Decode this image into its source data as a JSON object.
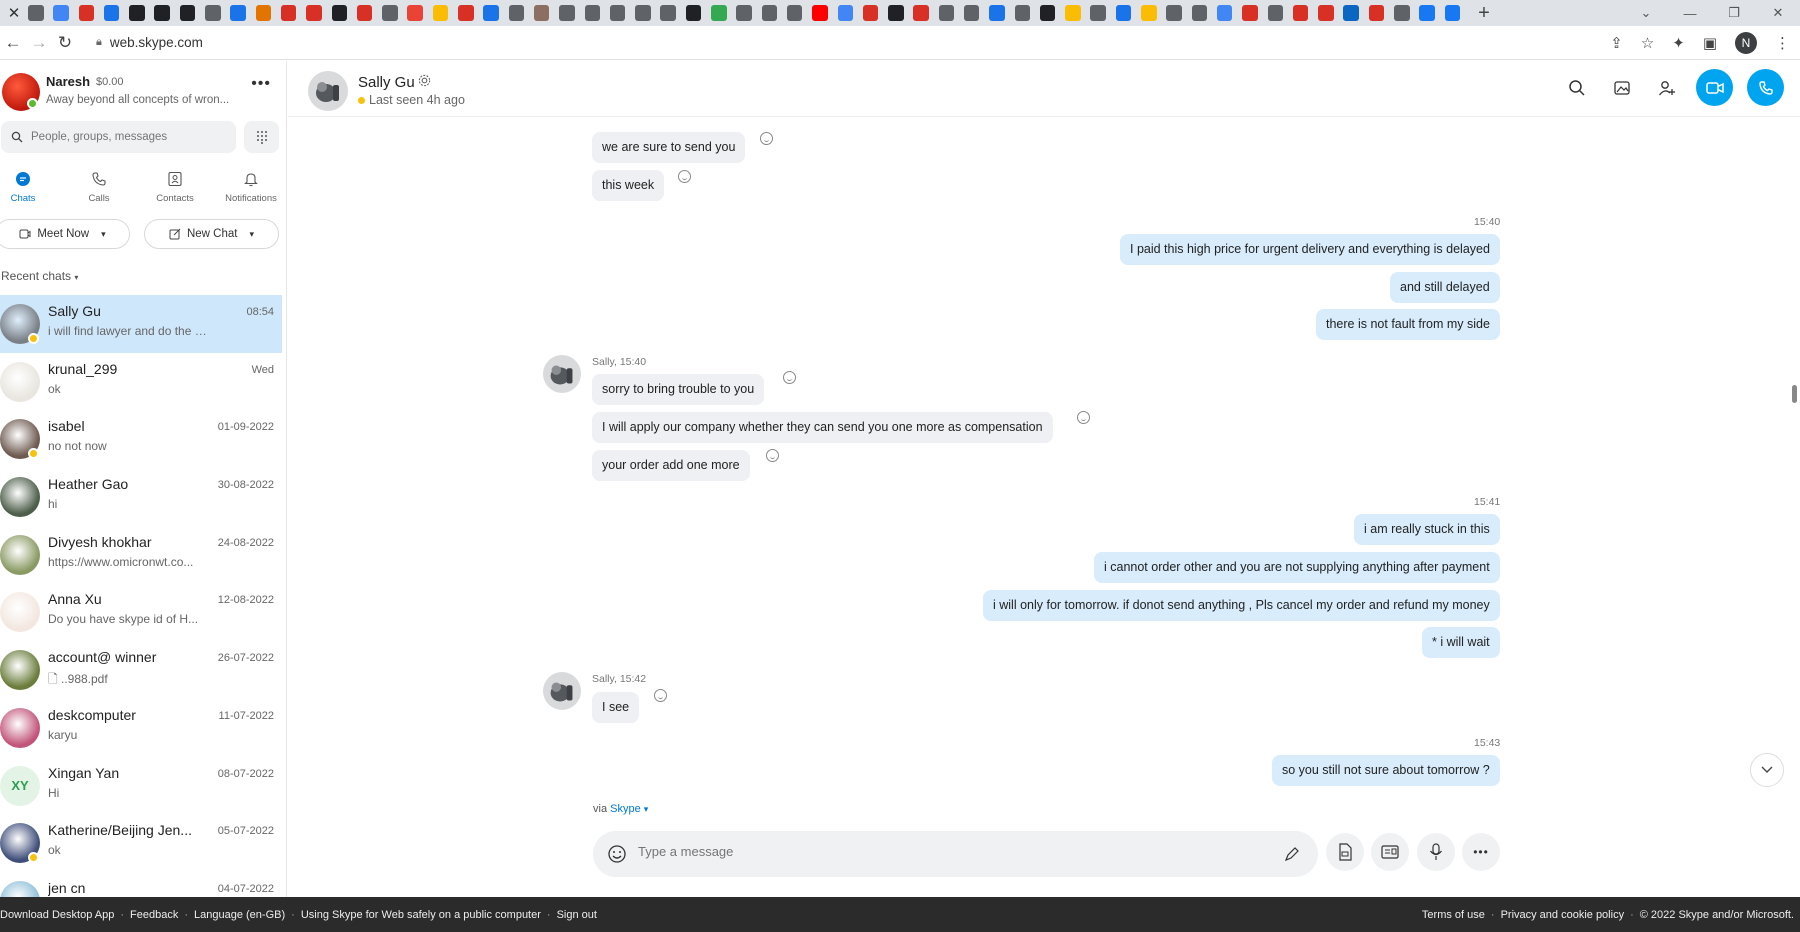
{
  "browser": {
    "url": "web.skype.com",
    "favicon_colors": [
      "#5f6368",
      "#4285f4",
      "#d93025",
      "#1a73e8",
      "#202124",
      "#202124",
      "#202124",
      "#5f6368",
      "#1a73e8",
      "#e37400",
      "#d93025",
      "#d93025",
      "#202124",
      "#d93025",
      "#5f6368",
      "#ea4335",
      "#fbbc04",
      "#d93025",
      "#1a73e8",
      "#5f6368",
      "#8d6e63",
      "#5f6368",
      "#5f6368",
      "#5f6368",
      "#5f6368",
      "#5f6368",
      "#202124",
      "#34a853",
      "#5f6368",
      "#5f6368",
      "#5f6368",
      "#ff0000",
      "#4285f4",
      "#d93025",
      "#202124",
      "#d93025",
      "#5f6368",
      "#5f6368",
      "#1a73e8",
      "#5f6368",
      "#202124",
      "#fbbc04",
      "#5f6368",
      "#1a73e8",
      "#fbbc04",
      "#5f6368",
      "#5f6368",
      "#4285f4",
      "#d93025",
      "#5f6368",
      "#d93025",
      "#d93025",
      "#0a66c2",
      "#d93025",
      "#5f6368",
      "#1877f2",
      "#1877f2"
    ],
    "profile_initial": "N"
  },
  "me": {
    "name": "Naresh",
    "credit": "$0.00",
    "mood": "Away beyond all concepts of wron..."
  },
  "search": {
    "placeholder": "People, groups, messages"
  },
  "nav": {
    "chats": "Chats",
    "calls": "Calls",
    "contacts": "Contacts",
    "notifications": "Notifications"
  },
  "actions": {
    "meet_now": "Meet Now",
    "new_chat": "New Chat"
  },
  "recent_label": "Recent chats",
  "chats": [
    {
      "name": "Sally Gu",
      "date": "08:54",
      "preview": "i will find lawyer and do the the ...",
      "color": "#7a7f86"
    },
    {
      "name": "krunal_299",
      "date": "Wed",
      "preview": "ok",
      "color": "#e9e5df"
    },
    {
      "name": "isabel",
      "date": "01-09-2022",
      "preview": "no not now",
      "color": "#6e5a50"
    },
    {
      "name": "Heather Gao",
      "date": "30-08-2022",
      "preview": "hi",
      "color": "#4d5e4a"
    },
    {
      "name": "Divyesh khokhar",
      "date": "24-08-2022",
      "preview": "https://www.omicronwt.co...",
      "color": "#8a9a63"
    },
    {
      "name": "Anna Xu",
      "date": "12-08-2022",
      "preview": "Do you have skype id of H...",
      "color": "#f3e7e0"
    },
    {
      "name": "account@ winner",
      "date": "26-07-2022",
      "preview": "..988.pdf",
      "color": "#6b7d3c"
    },
    {
      "name": "deskcomputer",
      "date": "11-07-2022",
      "preview": "karyu",
      "color": "#c2557a"
    },
    {
      "name": "Xingan  Yan",
      "date": "08-07-2022",
      "preview": "Hi",
      "initials": "XY"
    },
    {
      "name": "Katherine/Beijing Jen...",
      "date": "05-07-2022",
      "preview": "ok",
      "color": "#3f4e7a"
    },
    {
      "name": "jen cn",
      "date": "04-07-2022",
      "preview": "",
      "color": "#8fbfd9"
    }
  ],
  "conversation": {
    "name": "Sally Gu",
    "status": "Last seen 4h ago",
    "messages": [
      {
        "text": "we are sure to send you"
      },
      {
        "text": "this week"
      },
      {
        "time": "15:40"
      },
      {
        "text": "I paid this high price for urgent delivery and everything is delayed"
      },
      {
        "text": "and still delayed"
      },
      {
        "text": "there is not fault from my side"
      },
      {
        "sender": "Sally, 15:40"
      },
      {
        "text": "sorry to bring trouble to you"
      },
      {
        "text": "I will apply our company whether they can send you one more as compensation"
      },
      {
        "text": "your order add one more"
      },
      {
        "time": "15:41"
      },
      {
        "text": "i am really stuck in this"
      },
      {
        "text": "i cannot order other and you are not supplying anything after payment"
      },
      {
        "text": "i will only for tomorrow. if donot send anything , Pls cancel my order and refund my money"
      },
      {
        "text": "* i will wait"
      },
      {
        "sender": "Sally, 15:42"
      },
      {
        "text": "I see"
      },
      {
        "time": "15:43"
      },
      {
        "text": "so you still not sure about tomorrow ?"
      }
    ]
  },
  "via": {
    "prefix": "via",
    "link": "Skype"
  },
  "composer": {
    "placeholder": "Type a message"
  },
  "footer": {
    "left": [
      "Download Desktop App",
      "Feedback",
      "Language (en-GB)",
      "Using Skype for Web safely on a public computer",
      "Sign out"
    ],
    "right": [
      "Terms of use",
      "Privacy and cookie policy",
      "© 2022 Skype and/or Microsoft."
    ]
  }
}
